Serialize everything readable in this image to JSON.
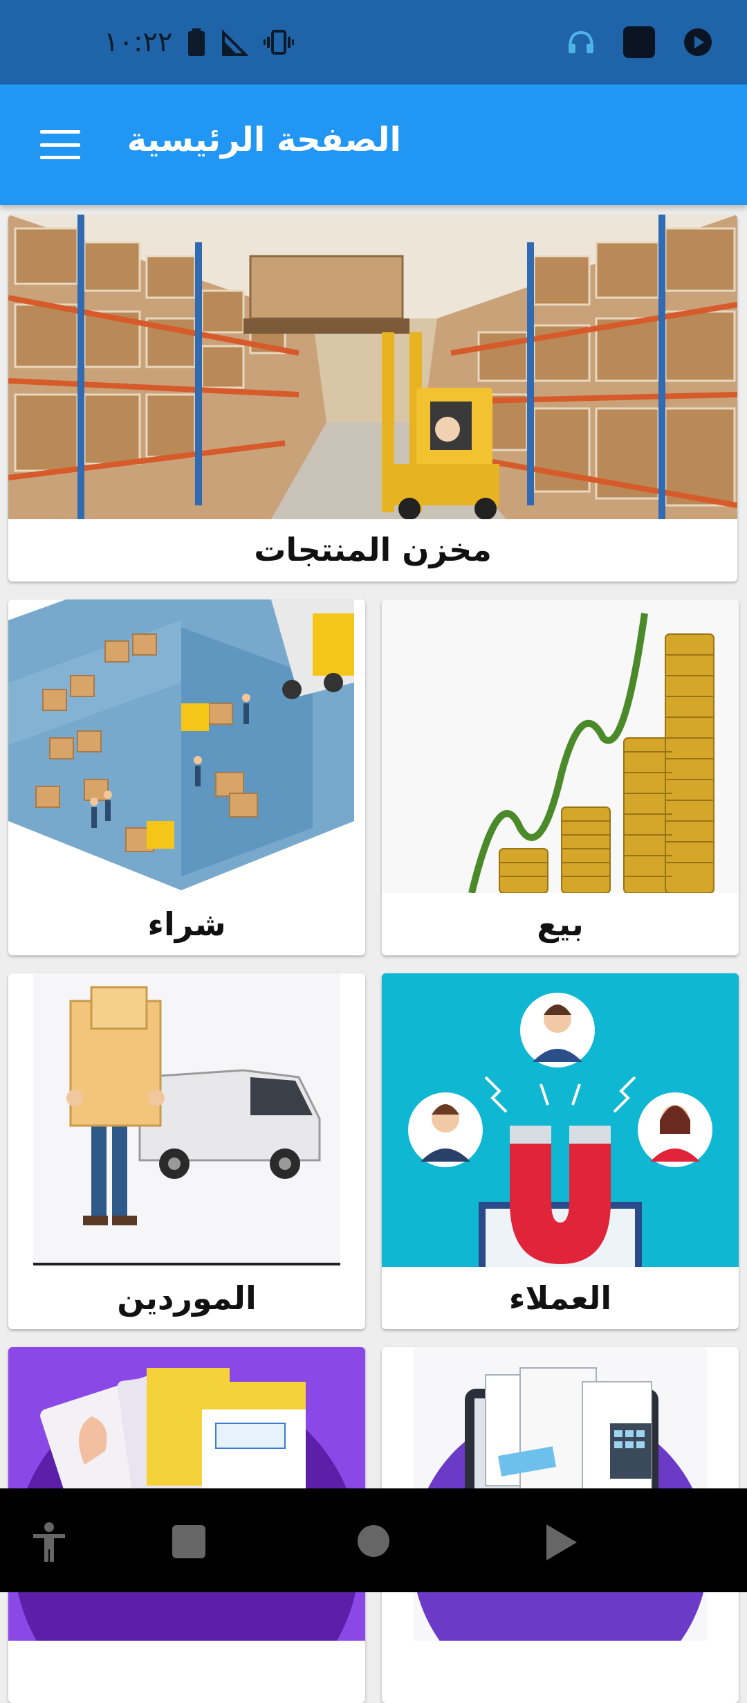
{
  "status_bar": {
    "time": "١٠:٢٢",
    "icons": [
      "battery-icon",
      "signal-icon",
      "vibrate-icon",
      "headset-icon",
      "app-square-icon",
      "play-circle-icon"
    ],
    "background": "#1f64a8"
  },
  "app_bar": {
    "title": "الصفحة الرئيسية",
    "background": "#2196f3",
    "menu_icon": "hamburger-menu-icon"
  },
  "cards": {
    "warehouse": {
      "label": "مخزن المنتجات",
      "image": "warehouse-forklift-photo"
    },
    "buy": {
      "label": "شراء",
      "image": "warehouse-isometric-illustration"
    },
    "sell": {
      "label": "بيع",
      "image": "coin-stacks-growth-photo"
    },
    "suppliers": {
      "label": "الموردين",
      "image": "delivery-man-van-illustration"
    },
    "customers": {
      "label": "العملاء",
      "image": "customer-magnet-illustration"
    },
    "invoices_left": {
      "label": "",
      "image": "invoice-cards-illustration"
    },
    "invoices_right": {
      "label": "",
      "image": "invoice-tablet-illustration"
    }
  },
  "nav_bar": {
    "buttons": [
      "accessibility-icon",
      "recents-square-icon",
      "home-circle-icon",
      "back-triangle-icon"
    ]
  }
}
